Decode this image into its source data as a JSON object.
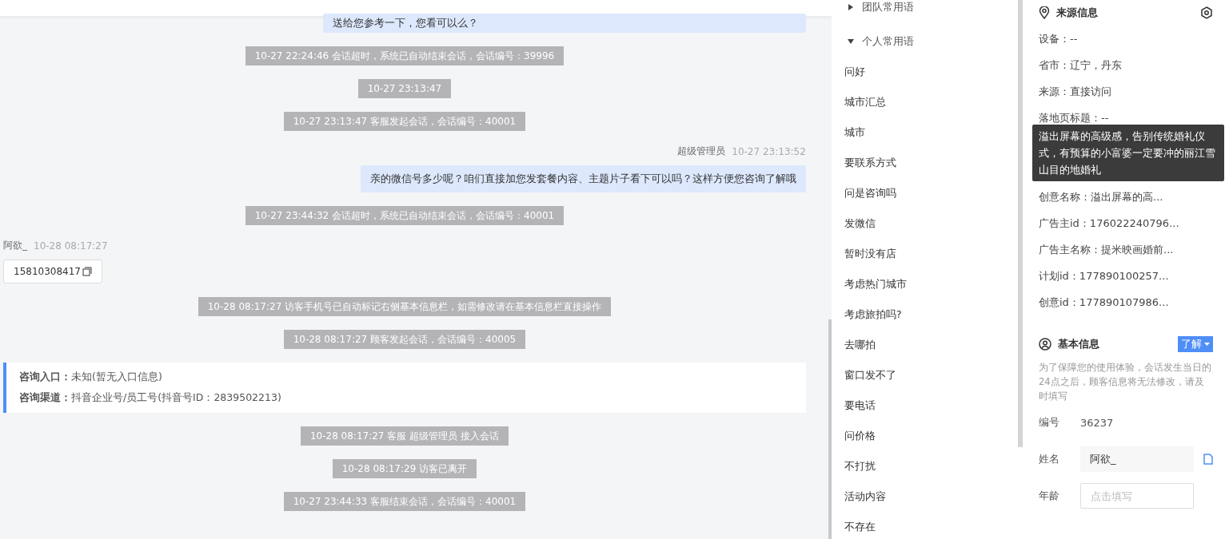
{
  "chat": {
    "messages": [
      {
        "kind": "agent_bubble",
        "text": "送给您参考一下，您看可以么？"
      },
      {
        "kind": "system",
        "text": "10-27 22:24:46 会话超时，系统已自动结束会话，会话编号：39996"
      },
      {
        "kind": "system",
        "text": "10-27 23:13:47"
      },
      {
        "kind": "system",
        "text": "10-27 23:13:47 客服发起会话，会话编号：40001"
      },
      {
        "kind": "agent_meta",
        "sender": "超级管理员",
        "time": "10-27 23:13:52"
      },
      {
        "kind": "agent_bubble",
        "text": "亲的微信号多少呢？咱们直接加您发套餐内容、主题片子看下可以吗？这样方便您咨询了解哦"
      },
      {
        "kind": "system",
        "text": "10-27 23:44:32 会话超时，系统已自动结束会话，会话编号：40001"
      },
      {
        "kind": "visitor_meta",
        "sender": "阿欲_",
        "time": "10-28 08:17:27"
      },
      {
        "kind": "visitor_bubble",
        "text": "15810308417"
      },
      {
        "kind": "system",
        "text": "10-28 08:17:27 访客手机号已自动标记右侧基本信息栏，如需修改请在基本信息栏直接操作"
      },
      {
        "kind": "system",
        "text": "10-28 08:17:27 顾客发起会话，会话编号：40005"
      },
      {
        "kind": "info_card",
        "lines": [
          {
            "label": "咨询入口：",
            "value": "未知(暂无入口信息)"
          },
          {
            "label": "咨询渠道：",
            "value": "抖音企业号/员工号(抖音号ID：2839502213)"
          }
        ]
      },
      {
        "kind": "system",
        "text": "10-28 08:17:27 客服 超级管理员 接入会话"
      },
      {
        "kind": "system",
        "text": "10-28 08:17:29 访客已离开"
      },
      {
        "kind": "system",
        "text": "10-27 23:44:33 客服结束会话，会话编号：40001"
      }
    ]
  },
  "phrases": {
    "groups": [
      {
        "title": "团队常用语",
        "expanded": false
      },
      {
        "title": "个人常用语",
        "expanded": true,
        "items": [
          "问好",
          "城市汇总",
          "城市",
          "要联系方式",
          "问是咨询吗",
          "发微信",
          "暂时没有店",
          "考虑热门城市",
          "考虑旅拍吗?",
          "去哪拍",
          "窗口发不了",
          "要电话",
          "问价格",
          "不打扰",
          "活动内容",
          "不存在"
        ]
      }
    ]
  },
  "source_info": {
    "title": "来源信息",
    "rows_above": [
      "设备：--",
      "省市：辽宁，丹东",
      "来源：直接访问",
      "落地页标题：--"
    ],
    "tooltip": "溢出屏幕的高级感，告别传统婚礼仪式，有预算的小富婆一定要冲的丽江雪山目的地婚礼",
    "rows_below": [
      "创意名称：溢出屏幕的高...",
      "广告主id：176022240796...",
      "广告主名称：提米映画婚前...",
      "计划id：177890100257...",
      "创意id：177890107986..."
    ]
  },
  "basic_info": {
    "title": "基本信息",
    "tag": "了解",
    "notice": "为了保障您的使用体验，会话发生当日的24点之后，顾客信息将无法修改，请及时填写",
    "fields": [
      {
        "kind": "text",
        "label": "编号",
        "value": "36237"
      },
      {
        "kind": "filled",
        "label": "姓名",
        "value": "阿欲_"
      },
      {
        "kind": "input",
        "label": "年龄",
        "placeholder": "点击填写"
      }
    ]
  }
}
